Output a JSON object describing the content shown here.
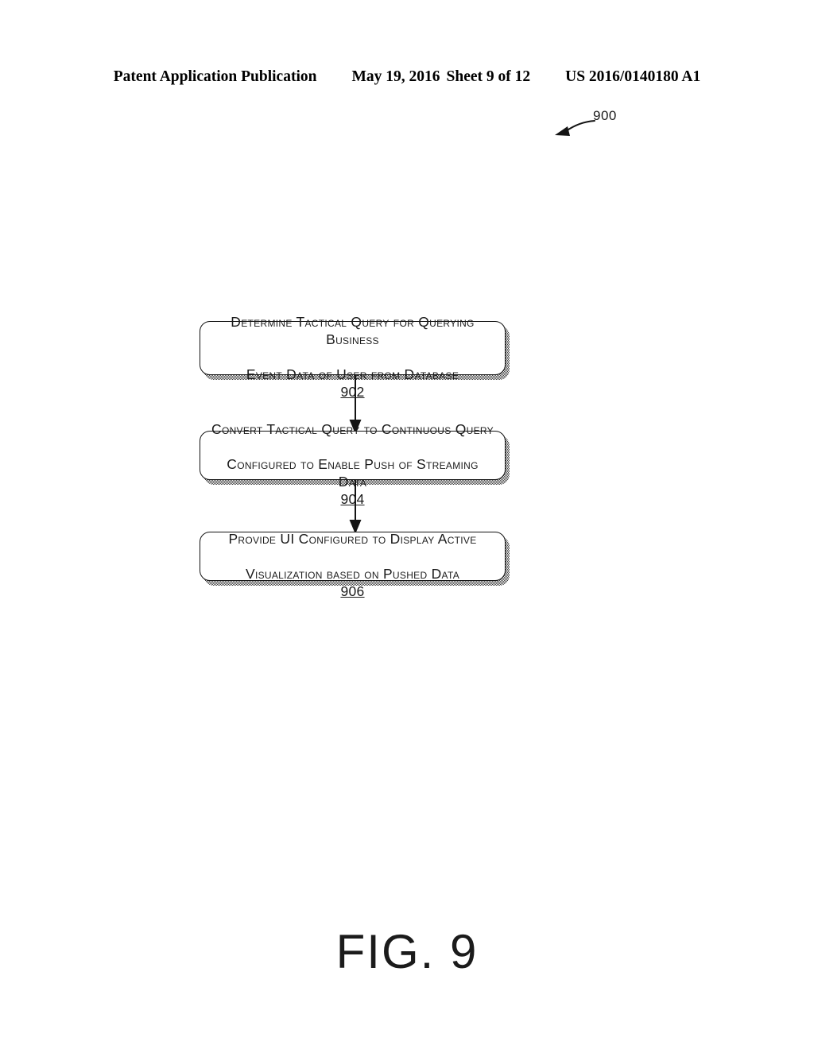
{
  "header": {
    "publication": "Patent Application Publication",
    "date": "May 19, 2016",
    "sheet": "Sheet 9 of 12",
    "patent_number": "US 2016/0140180 A1"
  },
  "figure": {
    "reference_numeral": "900",
    "caption": "FIG. 9",
    "lead_line_icon": "curved-arrow-icon"
  },
  "flowchart": {
    "type": "flowchart",
    "orientation": "vertical",
    "steps": [
      {
        "id": "902",
        "line1": "Determine Tactical Query for Querying Business",
        "line2": "Event Data of User from Database",
        "refnum": "902"
      },
      {
        "id": "904",
        "line1": "Convert Tactical Query to Continuous Query",
        "line2": "Configured to Enable Push of Streaming Data",
        "refnum": "904"
      },
      {
        "id": "906",
        "line1": "Provide UI Configured to Display Active",
        "line2": "Visualization based on Pushed Data",
        "refnum": "906"
      }
    ],
    "connectors": [
      {
        "from": "902",
        "to": "904",
        "icon": "down-arrow-icon"
      },
      {
        "from": "904",
        "to": "906",
        "icon": "down-arrow-icon"
      }
    ]
  },
  "colors": {
    "ink": "#111111",
    "paper": "#ffffff",
    "shadow": "#3a3a3a"
  }
}
